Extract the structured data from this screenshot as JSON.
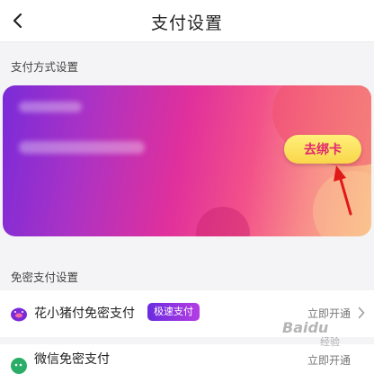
{
  "header": {
    "title": "支付设置",
    "back_icon": "chevron-left-icon"
  },
  "payment_methods": {
    "section_label": "支付方式设置",
    "bind_card_label": "去绑卡",
    "card_colors": {
      "start": "#7a2bd9",
      "mid": "#e0309c",
      "end": "#f9c187"
    }
  },
  "password_free": {
    "section_label": "免密支付设置",
    "items": [
      {
        "title": "花小猪付免密支付",
        "badge": "极速支付",
        "action": "立即开通",
        "icon": "pig-pay-icon"
      },
      {
        "title": "微信免密支付",
        "action": "立即开通",
        "icon": "wechat-icon"
      }
    ]
  },
  "watermark": {
    "line1": "Baidu",
    "line2": "经验"
  },
  "colors": {
    "accent_text": "#e0266e",
    "badge": "#6a2be0",
    "button": "#f9d64a"
  }
}
